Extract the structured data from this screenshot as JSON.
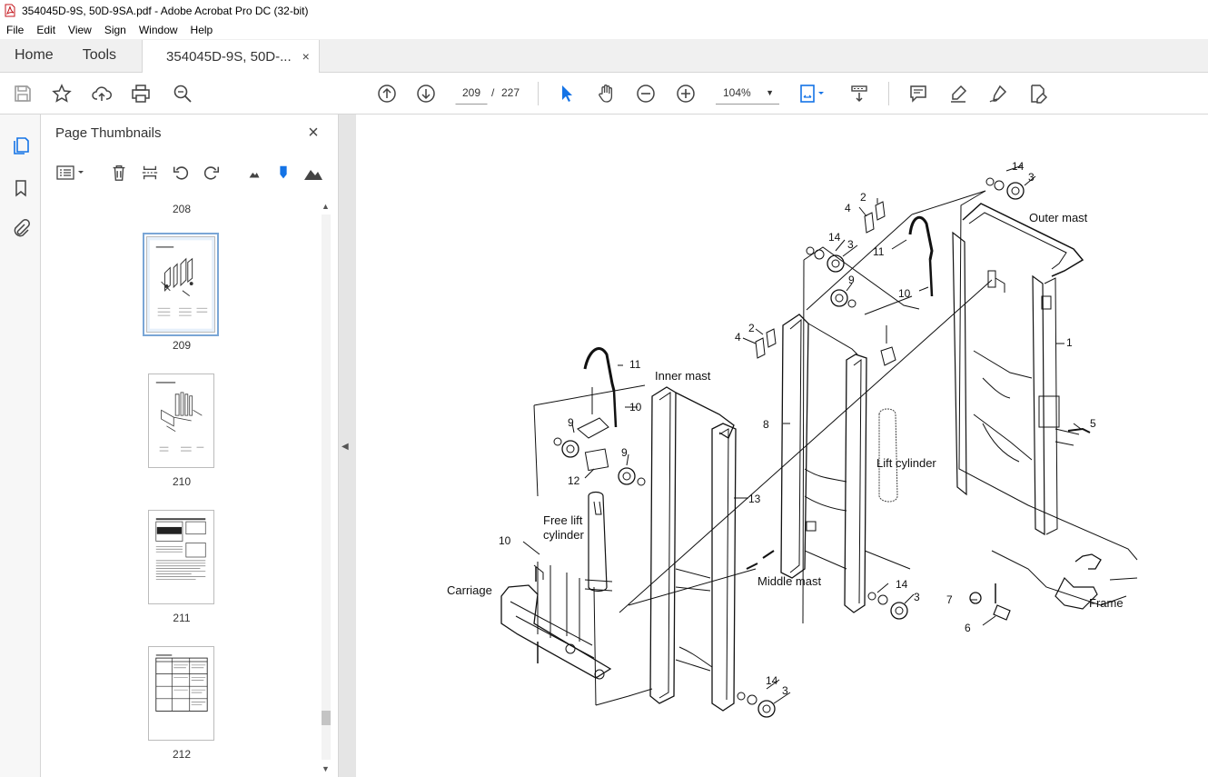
{
  "window": {
    "title": "354045D-9S, 50D-9SA.pdf - Adobe Acrobat Pro DC (32-bit)"
  },
  "menu": [
    "File",
    "Edit",
    "View",
    "Sign",
    "Window",
    "Help"
  ],
  "tabs": {
    "home": "Home",
    "tools": "Tools",
    "document": "354045D-9S, 50D-...",
    "close": "×"
  },
  "toolbar": {
    "page_current": "209",
    "page_separator": "/",
    "page_total": "227",
    "zoom": "104%"
  },
  "panel": {
    "title": "Page Thumbnails",
    "close": "×",
    "thumbnails": [
      {
        "label": "208"
      },
      {
        "label": "209"
      },
      {
        "label": "210"
      },
      {
        "label": "211"
      },
      {
        "label": "212"
      }
    ]
  },
  "diagram": {
    "labels": {
      "outer_mast": "Outer mast",
      "inner_mast": "Inner mast",
      "middle_mast": "Middle mast",
      "lift_cylinder": "Lift cylinder",
      "free_lift_cylinder_1": "Free lift",
      "free_lift_cylinder_2": "cylinder",
      "carriage": "Carriage",
      "frame": "Frame"
    },
    "callouts": [
      {
        "id": "c14a",
        "text": "14"
      },
      {
        "id": "c3a",
        "text": "3"
      },
      {
        "id": "c2a",
        "text": "2"
      },
      {
        "id": "c4a",
        "text": "4"
      },
      {
        "id": "c14b",
        "text": "14"
      },
      {
        "id": "c3b",
        "text": "3"
      },
      {
        "id": "c11a",
        "text": "11"
      },
      {
        "id": "c9a",
        "text": "9"
      },
      {
        "id": "c10a",
        "text": "10"
      },
      {
        "id": "c1",
        "text": "1"
      },
      {
        "id": "c2b",
        "text": "2"
      },
      {
        "id": "c4b",
        "text": "4"
      },
      {
        "id": "c8",
        "text": "8"
      },
      {
        "id": "c5",
        "text": "5"
      },
      {
        "id": "c11b",
        "text": "11"
      },
      {
        "id": "c10b",
        "text": "10"
      },
      {
        "id": "c9b",
        "text": "9"
      },
      {
        "id": "c9c",
        "text": "9"
      },
      {
        "id": "c12",
        "text": "12"
      },
      {
        "id": "c13",
        "text": "13"
      },
      {
        "id": "c10c",
        "text": "10"
      },
      {
        "id": "c14c",
        "text": "14"
      },
      {
        "id": "c3c",
        "text": "3"
      },
      {
        "id": "c7",
        "text": "7"
      },
      {
        "id": "c6",
        "text": "6"
      },
      {
        "id": "c14d",
        "text": "14"
      },
      {
        "id": "c3d",
        "text": "3"
      }
    ]
  }
}
